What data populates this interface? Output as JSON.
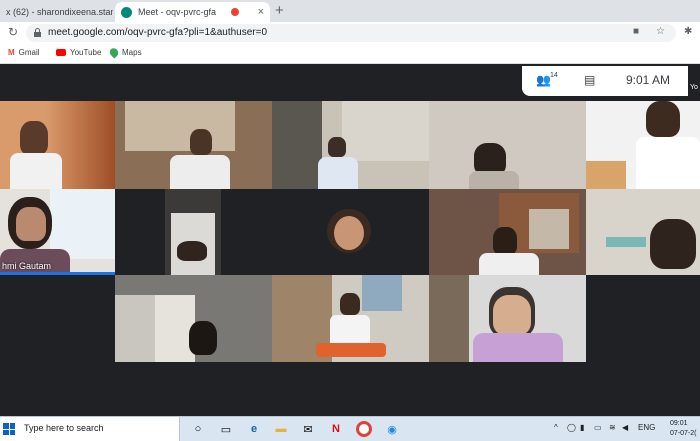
{
  "browser": {
    "tabs": [
      {
        "label": "x (62) - sharondixeena.stanle",
        "active": false
      },
      {
        "label": "Meet - oqv-pvrc-gfa",
        "active": true
      }
    ],
    "url": "meet.google.com/oqv-pvrc-gfa?pli=1&authuser=0",
    "bookmarks": [
      {
        "label": "Gmail",
        "icon": "gmail-icon"
      },
      {
        "label": "YouTube",
        "icon": "youtube-icon"
      },
      {
        "label": "Maps",
        "icon": "maps-icon"
      }
    ]
  },
  "meet": {
    "participant_count": "14",
    "time": "9:01 AM",
    "self_label": "Yo",
    "participants": [
      {
        "name": "",
        "bg": "#b86a3a"
      },
      {
        "name": "",
        "bg": "#8a6e55"
      },
      {
        "name": "",
        "bg": "#c9c2b6"
      },
      {
        "name": "",
        "bg": "#cfc9c1"
      },
      {
        "name": "",
        "bg": "#f2f2f2"
      },
      {
        "name": "hmi Gautam",
        "bg": "#e5e2dd"
      },
      {
        "name": "",
        "bg": "#3b3a38"
      },
      {
        "name": "",
        "bg": "#202124"
      },
      {
        "name": "",
        "bg": "#6e5446"
      },
      {
        "name": "",
        "bg": "#d8d4cc"
      },
      {
        "name": "",
        "bg": "#7a7874"
      },
      {
        "name": "",
        "bg": "#cfcac2"
      },
      {
        "name": "",
        "bg": "#d9d9d9"
      }
    ]
  },
  "taskbar": {
    "search_placeholder": "Type here to search",
    "lang": "ENG",
    "time": "09:01",
    "date": "07-07-2("
  },
  "colors": {
    "accent": "#1a73e8",
    "meet_bg": "#202124"
  }
}
